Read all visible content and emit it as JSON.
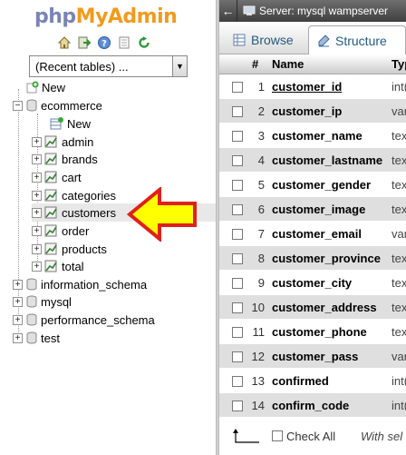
{
  "logo": {
    "php": "php",
    "my": "My",
    "admin": "Admin"
  },
  "nav_icons": [
    "home-icon",
    "exit-icon",
    "help-icon",
    "docs-icon",
    "reload-icon"
  ],
  "recent_tables": {
    "selected": "(Recent tables) ..."
  },
  "tree": {
    "new_label": "New",
    "databases": [
      {
        "name": "ecommerce",
        "expanded": true,
        "children_new": "New",
        "tables": [
          "admin",
          "brands",
          "cart",
          "categories",
          "customers",
          "order",
          "products",
          "total"
        ],
        "selected_table": "customers"
      },
      {
        "name": "information_schema",
        "expanded": false
      },
      {
        "name": "mysql",
        "expanded": false
      },
      {
        "name": "performance_schema",
        "expanded": false
      },
      {
        "name": "test",
        "expanded": false
      }
    ]
  },
  "server_bar": {
    "back": "←",
    "label": "Server: mysql wampserver"
  },
  "tabs": [
    {
      "label": "Browse",
      "icon": "browse-icon",
      "active": false
    },
    {
      "label": "Structure",
      "icon": "structure-icon",
      "active": true
    }
  ],
  "table": {
    "headers": {
      "hash": "#",
      "name": "Name",
      "type": "Typ"
    },
    "rows": [
      {
        "num": "1",
        "name": "customer_id",
        "type": "int(",
        "primary": true
      },
      {
        "num": "2",
        "name": "customer_ip",
        "type": "var"
      },
      {
        "num": "3",
        "name": "customer_name",
        "type": "tex"
      },
      {
        "num": "4",
        "name": "customer_lastname",
        "type": "tex"
      },
      {
        "num": "5",
        "name": "customer_gender",
        "type": "tex"
      },
      {
        "num": "6",
        "name": "customer_image",
        "type": "tex"
      },
      {
        "num": "7",
        "name": "customer_email",
        "type": "var"
      },
      {
        "num": "8",
        "name": "customer_province",
        "type": "tex"
      },
      {
        "num": "9",
        "name": "customer_city",
        "type": "tex"
      },
      {
        "num": "10",
        "name": "customer_address",
        "type": "tex"
      },
      {
        "num": "11",
        "name": "customer_phone",
        "type": "tex"
      },
      {
        "num": "12",
        "name": "customer_pass",
        "type": "var"
      },
      {
        "num": "13",
        "name": "confirmed",
        "type": "int("
      },
      {
        "num": "14",
        "name": "confirm_code",
        "type": "int("
      }
    ]
  },
  "footer": {
    "check_all": "Check All",
    "with_selected": "With sel"
  },
  "colors": {
    "accent_link": "#235a81",
    "logo_orange": "#f29a1d",
    "logo_php": "#7a84b7",
    "arrow_fill": "#ffff00",
    "arrow_stroke": "#e0201b"
  }
}
